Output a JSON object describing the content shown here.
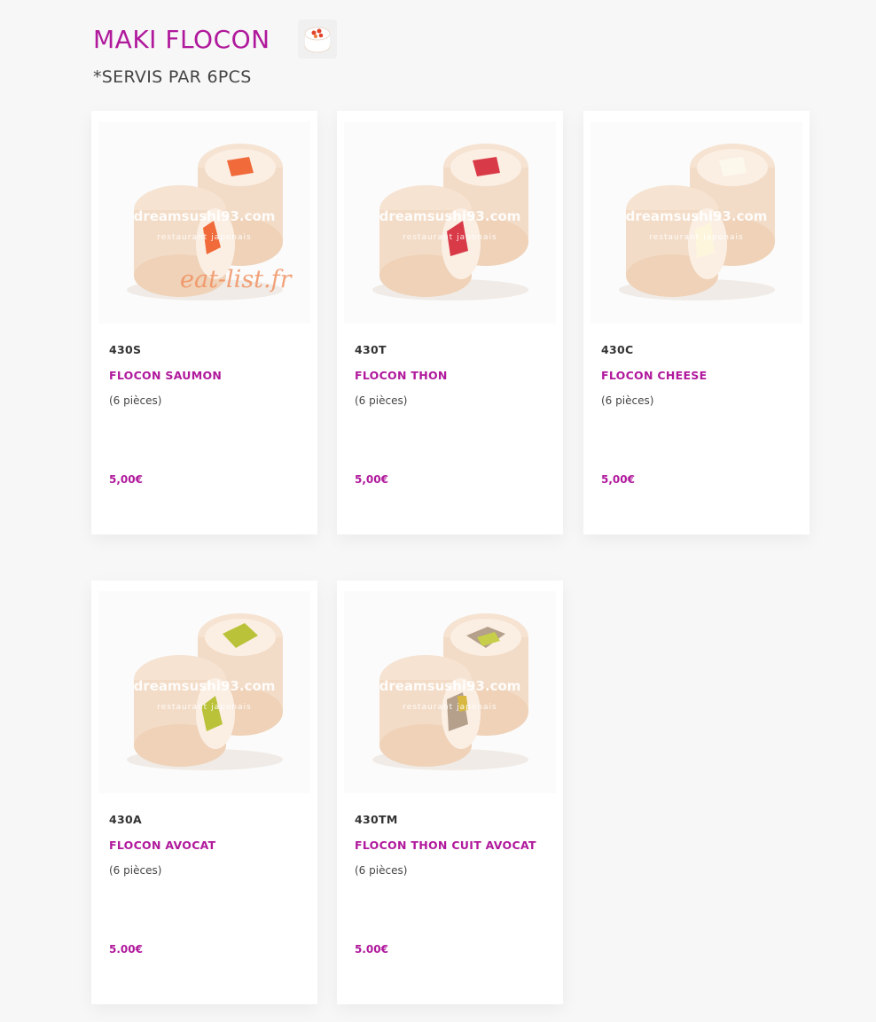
{
  "header": {
    "title": "MAKI FLOCON",
    "subtitle": "*SERVIS PAR 6PCS",
    "icon": "sushi-roll-icon"
  },
  "watermark": {
    "site": "dreamsushi93.com",
    "tagline": "restaurant japonais",
    "overlay": "eat-list.fr"
  },
  "colors": {
    "accent": "#b0199c",
    "rice": "#f3dcc7",
    "background": "#f7f7f7"
  },
  "products": [
    {
      "code": "430S",
      "name": "FLOCON SAUMON",
      "pieces": "(6 pièces)",
      "price": "5,00€",
      "filling": "saumon",
      "filling_color": "#f06a3a"
    },
    {
      "code": "430T",
      "name": "FLOCON THON",
      "pieces": "(6 pièces)",
      "price": "5,00€",
      "filling": "thon",
      "filling_color": "#d93a48"
    },
    {
      "code": "430C",
      "name": "FLOCON CHEESE",
      "pieces": "(6 pièces)",
      "price": "5,00€",
      "filling": "cheese",
      "filling_color": "#fbf6e6"
    },
    {
      "code": "430A",
      "name": "FLOCON AVOCAT",
      "pieces": "(6 pièces)",
      "price": "5.00€",
      "filling": "avocat",
      "filling_color": "#b9c238"
    },
    {
      "code": "430TM",
      "name": "FLOCON THON CUIT AVOCAT",
      "pieces": "(6 pièces)",
      "price": "5.00€",
      "filling": "thon cuit avocat",
      "filling_color": "#b5a08c"
    }
  ]
}
